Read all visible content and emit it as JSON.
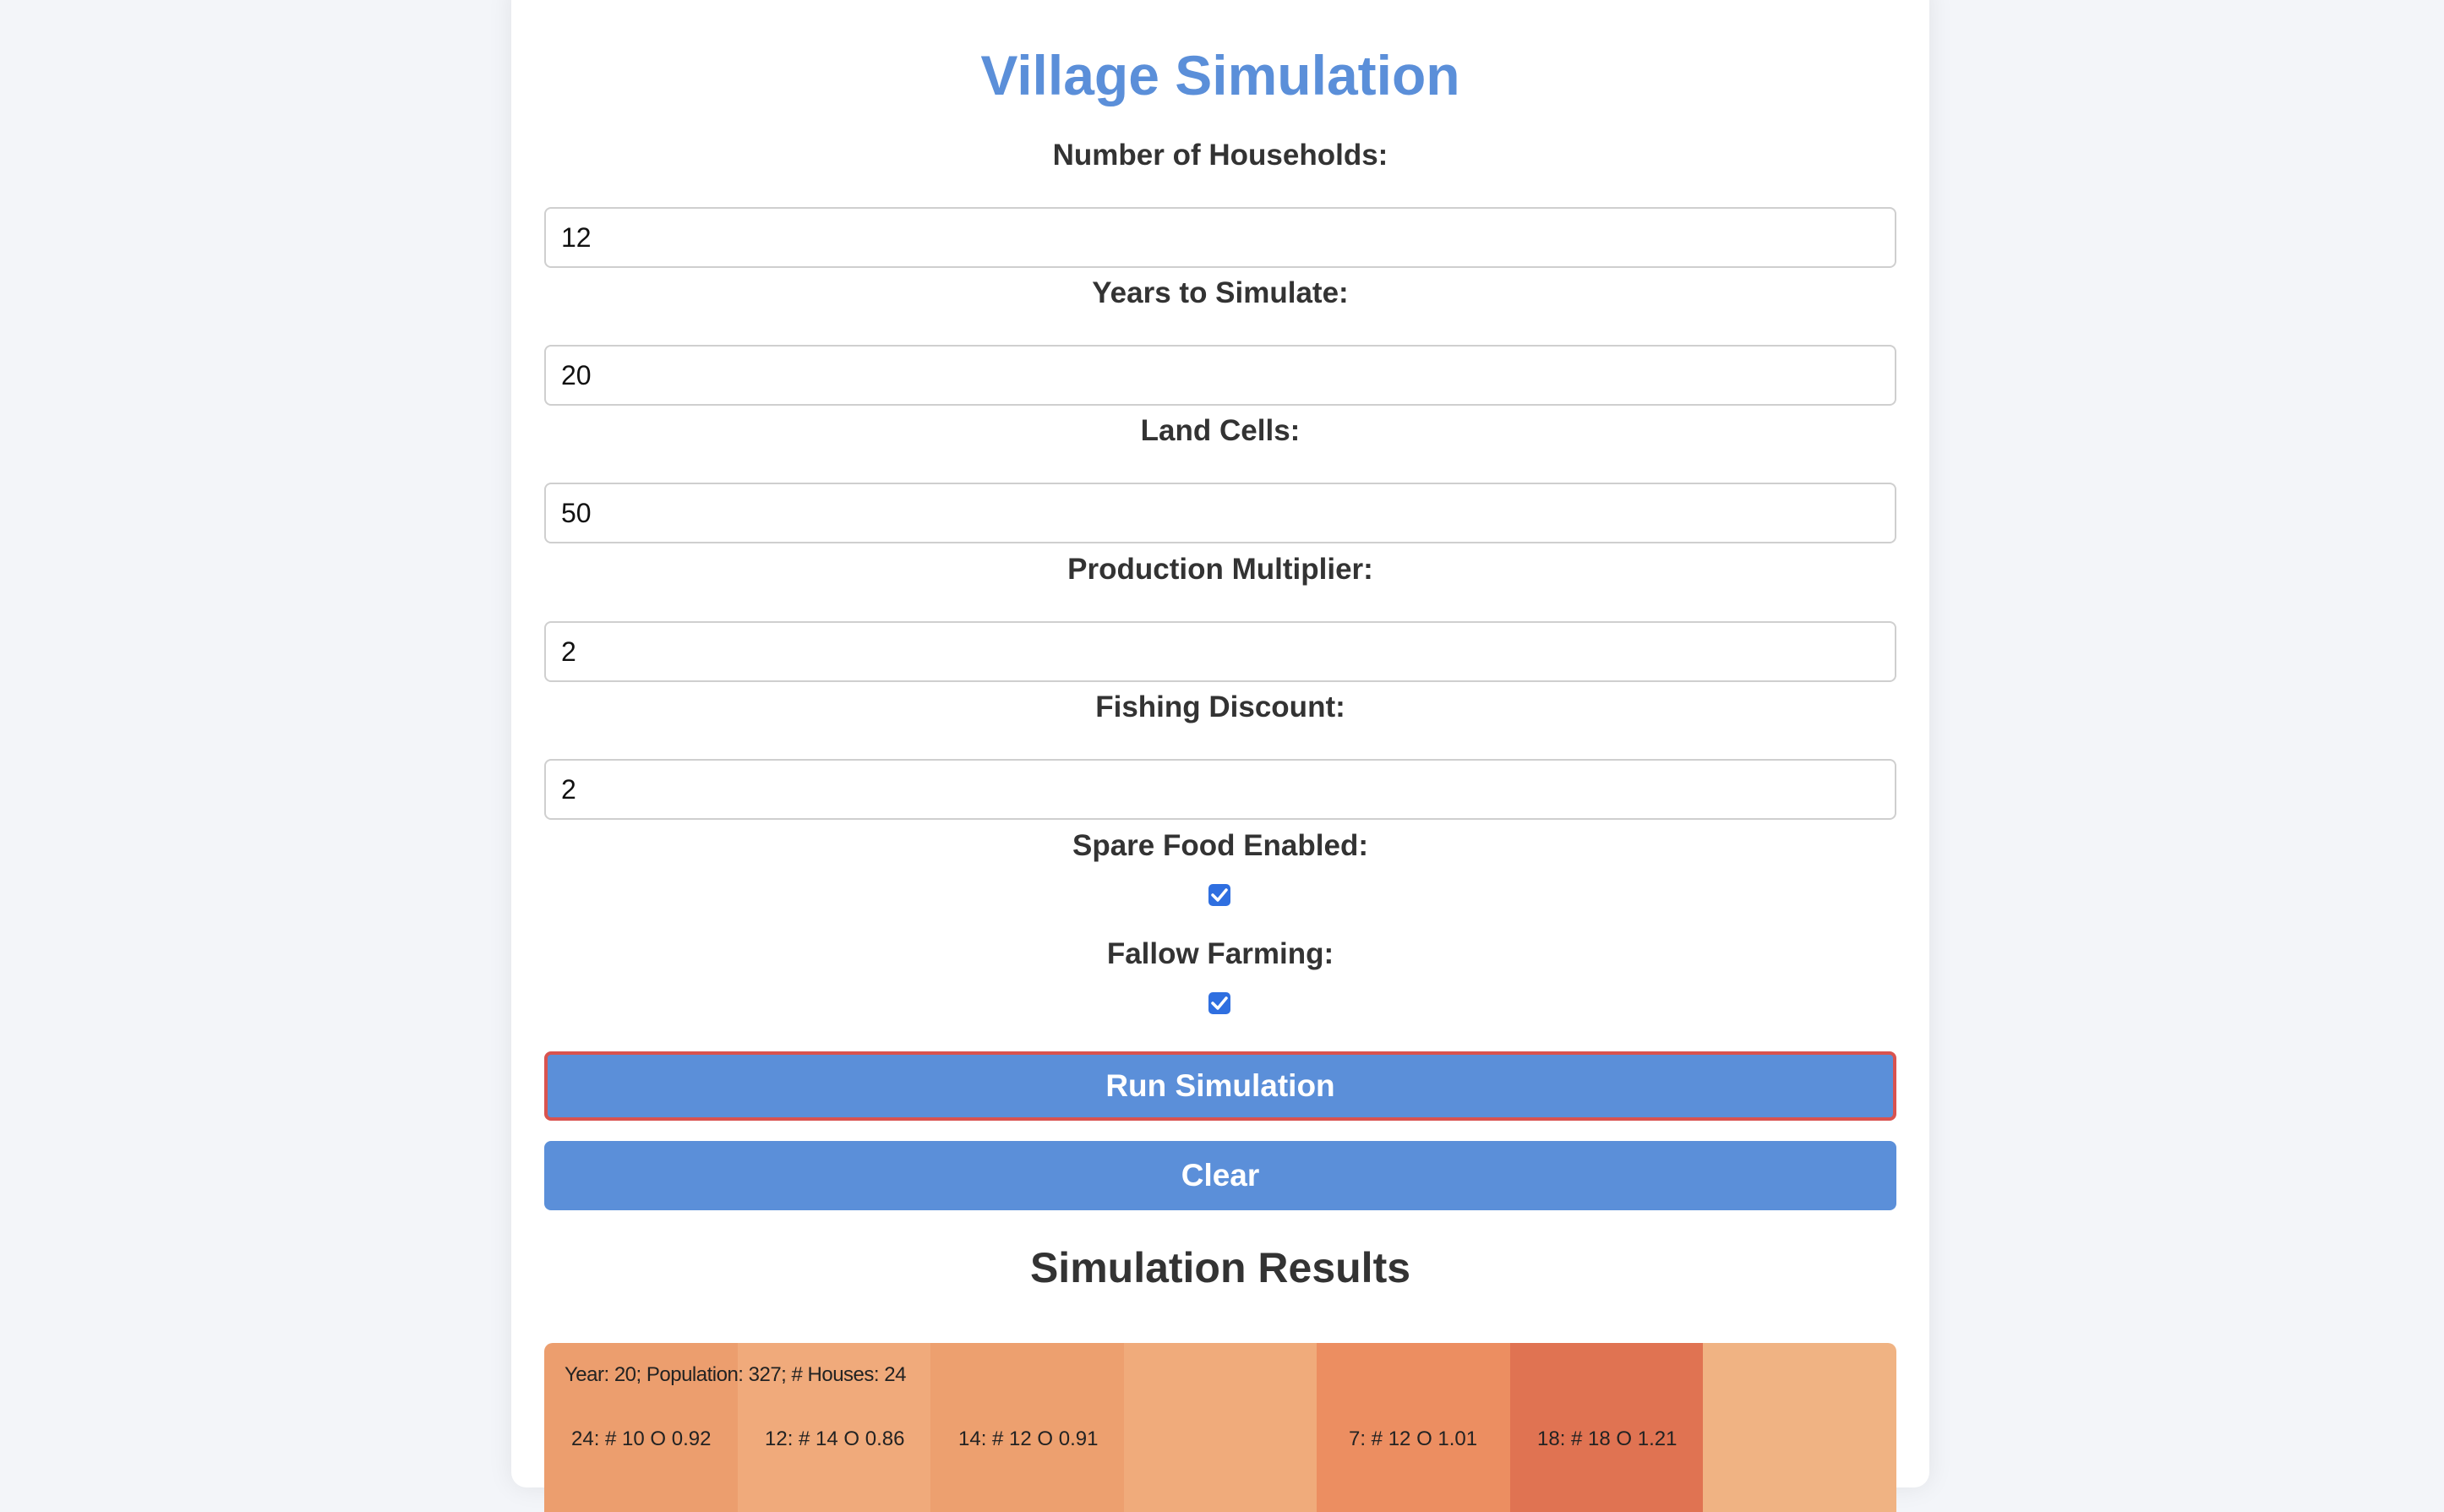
{
  "title": "Village Simulation",
  "form": {
    "households": {
      "label": "Number of Households:",
      "value": "12"
    },
    "years": {
      "label": "Years to Simulate:",
      "value": "20"
    },
    "land_cells": {
      "label": "Land Cells:",
      "value": "50"
    },
    "production_multiplier": {
      "label": "Production Multiplier:",
      "value": "2"
    },
    "fishing_discount": {
      "label": "Fishing Discount:",
      "value": "2"
    },
    "spare_food": {
      "label": "Spare Food Enabled:",
      "checked": true
    },
    "fallow_farming": {
      "label": "Fallow Farming:",
      "checked": true
    }
  },
  "buttons": {
    "run": "Run Simulation",
    "clear": "Clear"
  },
  "results": {
    "title": "Simulation Results",
    "summary": "Year: 20; Population: 327; # Houses: 24",
    "cells": [
      {
        "label": "24: # 10 O 0.92",
        "color": "#ec9e6e"
      },
      {
        "label": "12: # 14 O 0.86",
        "color": "#f0aa7b"
      },
      {
        "label": "14: # 12 O 0.91",
        "color": "#eda06f"
      },
      {
        "label": "",
        "color": "#f0ab7b"
      },
      {
        "label": "7: # 12 O 1.01",
        "color": "#ec8e61"
      },
      {
        "label": "18: # 18 O 1.21",
        "color": "#e07352"
      },
      {
        "label": "",
        "color": "#f0b383"
      }
    ]
  },
  "colors": {
    "accent": "#5b8fd9",
    "focus_border": "#d9534f",
    "checkbox": "#2f6fe0"
  }
}
